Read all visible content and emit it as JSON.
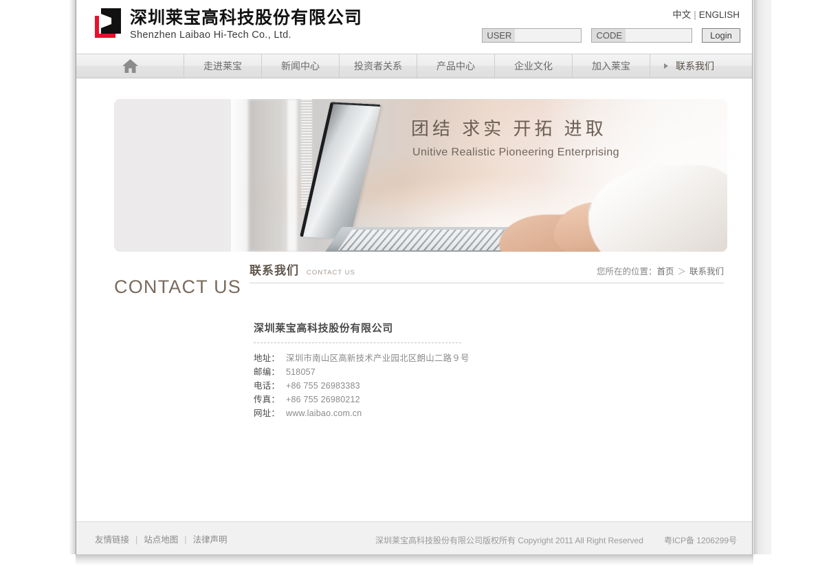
{
  "header": {
    "logo": {
      "cn": "深圳莱宝高科技股份有限公司",
      "en": "Shenzhen Laibao Hi-Tech Co., Ltd.",
      "mark_black": "#111111",
      "mark_red": "#e8112d"
    },
    "language": {
      "chinese": "中文",
      "separator": "|",
      "english": "ENGLISH"
    },
    "login": {
      "user_label": "USER",
      "user_value": "",
      "user_placeholder": "",
      "code_label": "CODE",
      "code_value": "",
      "code_placeholder": "",
      "button": "Login"
    }
  },
  "nav": {
    "home_icon": "home-icon",
    "items": [
      {
        "label": "走进莱宝",
        "active": false
      },
      {
        "label": "新闻中心",
        "active": false
      },
      {
        "label": "投资者关系",
        "active": false
      },
      {
        "label": "产品中心",
        "active": false
      },
      {
        "label": "企业文化",
        "active": false
      },
      {
        "label": "加入莱宝",
        "active": false
      },
      {
        "label": "联系我们",
        "active": true
      }
    ]
  },
  "banner": {
    "slogan_cn": "团结  求实  开拓  进取",
    "slogan_en": "Unitive Realistic Pioneering Enterprising"
  },
  "content": {
    "page_title": "CONTACT US",
    "section_cn": "联系我们",
    "section_en": "CONTACT US",
    "breadcrumb": {
      "prefix": "您所在的位置：",
      "home": "首页",
      "separator": "＞",
      "current": "联系我们"
    },
    "company_name": "深圳莱宝高科技股份有限公司",
    "info": [
      {
        "label": "地址：",
        "value": "深圳市南山区高新技术产业园北区朗山二路９号"
      },
      {
        "label": "邮编：",
        "value": "518057"
      },
      {
        "label": "电话：",
        "value": "+86 755 26983383"
      },
      {
        "label": "传真：",
        "value": "+86 755 26980212"
      },
      {
        "label": "网址：",
        "value": "www.laibao.com.cn"
      }
    ]
  },
  "footer": {
    "links": [
      {
        "label": "友情链接"
      },
      {
        "label": "站点地图"
      },
      {
        "label": "法律声明"
      }
    ],
    "separator": "|",
    "copyright": "深圳莱宝高科技股份有限公司版权所有 Copyright 2011 All Right Reserved",
    "icp": "粤ICP备 1206299号"
  },
  "colors": {
    "accent_brown": "#6b5f55",
    "nav_text": "#6a6a6a",
    "page_bg": "#ffffff",
    "footer_bg": "#f1f1f1"
  }
}
